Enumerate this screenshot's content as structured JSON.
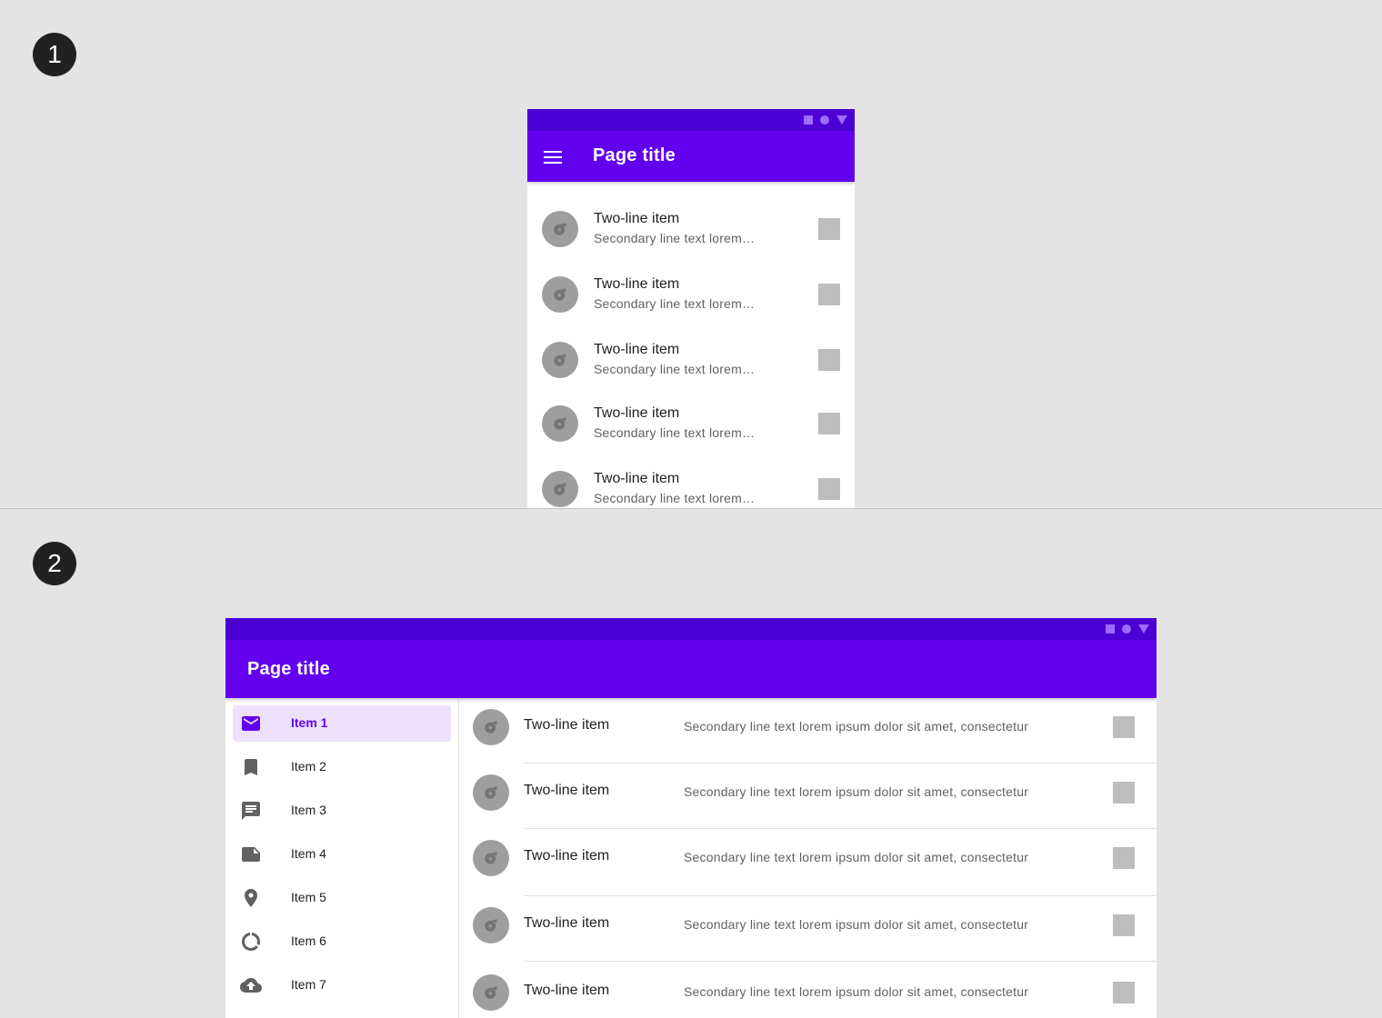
{
  "steps": {
    "first": "1",
    "second": "2"
  },
  "colors": {
    "primary": "#6200ee",
    "status_bar": "#4b00d4",
    "nav_active_bg": "#ede0fb",
    "background": "#e4e4e4"
  },
  "phone": {
    "title": "Page title",
    "menu_icon": "menu-icon",
    "list": [
      {
        "primary": "Two-line item",
        "secondary": "Secondary line text lorem…"
      },
      {
        "primary": "Two-line item",
        "secondary": "Secondary line text lorem…"
      },
      {
        "primary": "Two-line item",
        "secondary": "Secondary line text lorem…"
      },
      {
        "primary": "Two-line item",
        "secondary": "Secondary line text lorem…"
      },
      {
        "primary": "Two-line item",
        "secondary": "Secondary line text lorem…"
      }
    ]
  },
  "tablet": {
    "title": "Page title",
    "nav": [
      {
        "label": "Item 1",
        "icon": "mail-icon",
        "active": true
      },
      {
        "label": "Item 2",
        "icon": "bookmark-icon",
        "active": false
      },
      {
        "label": "Item 3",
        "icon": "chat-icon",
        "active": false
      },
      {
        "label": "Item 4",
        "icon": "note-icon",
        "active": false
      },
      {
        "label": "Item 5",
        "icon": "location-pin-icon",
        "active": false
      },
      {
        "label": "Item 6",
        "icon": "loading-circle-icon",
        "active": false
      },
      {
        "label": "Item 7",
        "icon": "cloud-upload-icon",
        "active": false
      }
    ],
    "list": [
      {
        "primary": "Two-line item",
        "secondary": "Secondary line text lorem ipsum dolor sit amet, consectetur"
      },
      {
        "primary": "Two-line item",
        "secondary": "Secondary line text lorem ipsum dolor sit amet, consectetur"
      },
      {
        "primary": "Two-line item",
        "secondary": "Secondary line text lorem ipsum dolor sit amet, consectetur"
      },
      {
        "primary": "Two-line item",
        "secondary": "Secondary line text lorem ipsum dolor sit amet, consectetur"
      },
      {
        "primary": "Two-line item",
        "secondary": "Secondary line text lorem ipsum dolor sit amet, consectetur"
      }
    ]
  }
}
